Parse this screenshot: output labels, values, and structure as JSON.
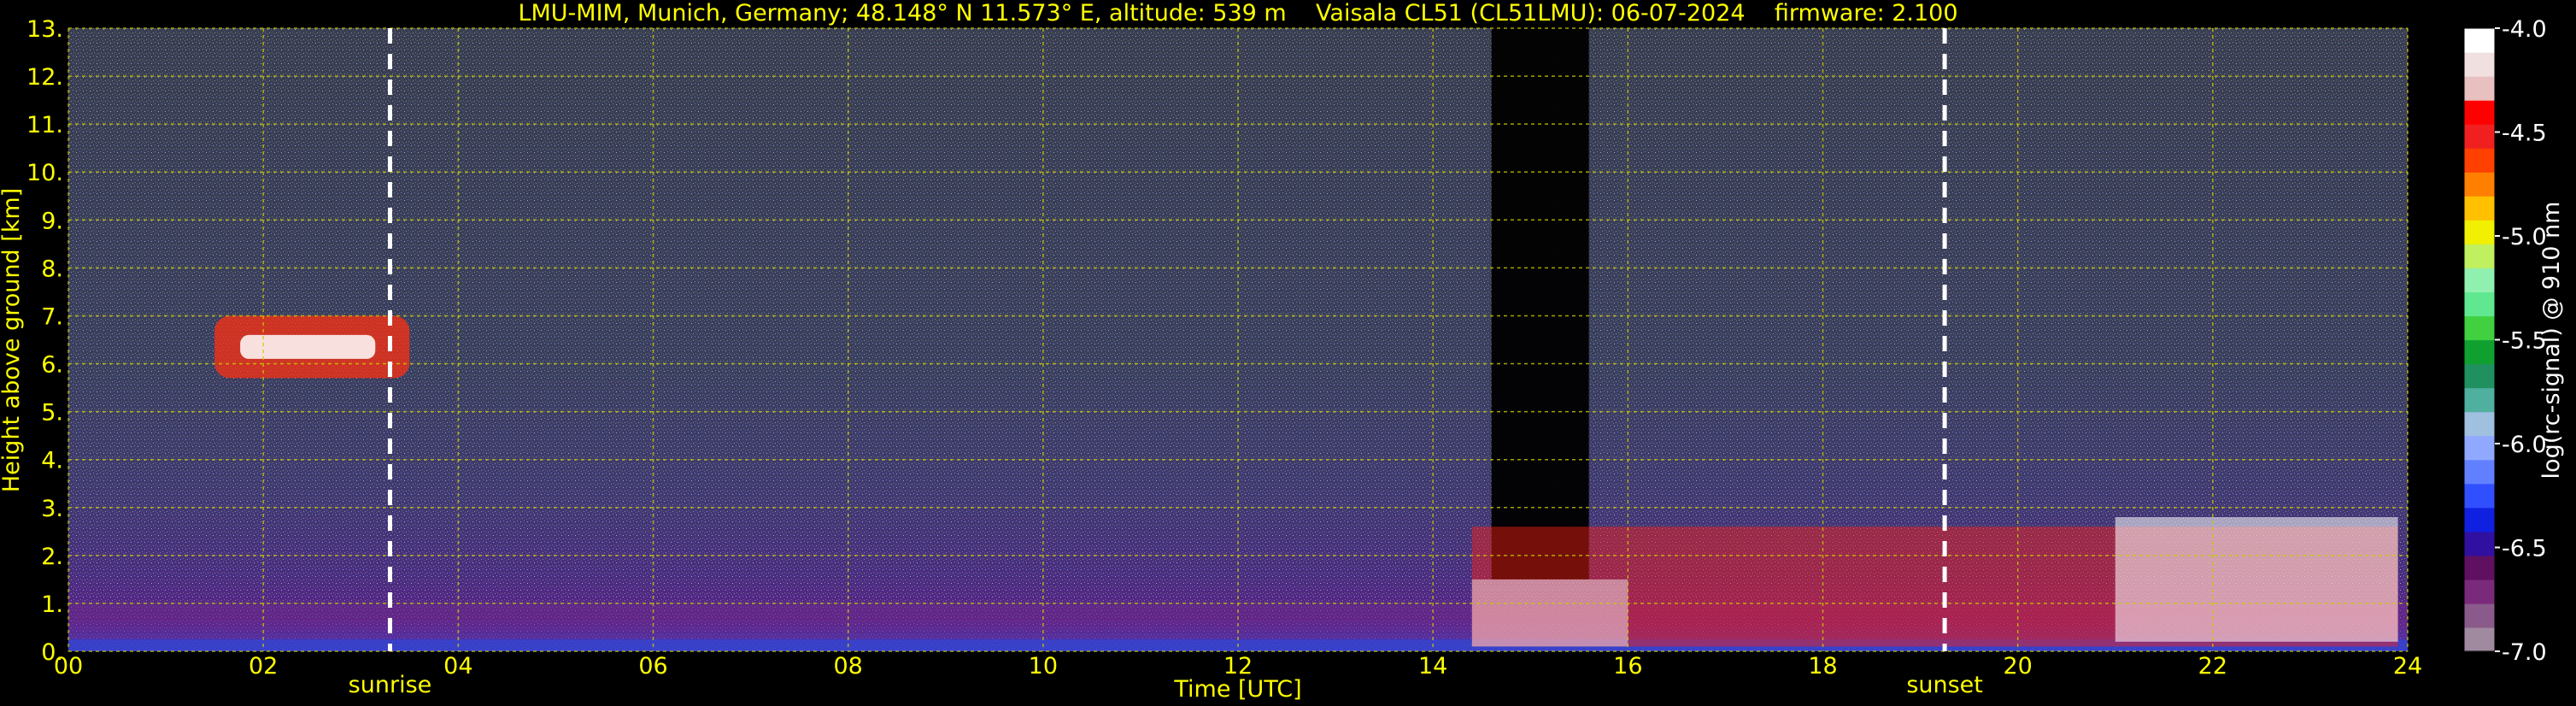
{
  "header": {
    "title": "LMU-MIM, Munich, Germany; 48.148° N 11.573° E, altitude: 539 m    Vaisala CL51 (CL51LMU): 06-07-2024    firmware: 2.100"
  },
  "chart_data": {
    "type": "heatmap",
    "title": "LMU-MIM, Munich, Germany; 48.148° N 11.573° E, altitude: 539 m    Vaisala CL51 (CL51LMU): 06-07-2024    firmware: 2.100",
    "xlabel": "Time [UTC]",
    "ylabel": "Height above ground [km]",
    "xlim": [
      0,
      24
    ],
    "ylim": [
      0,
      13
    ],
    "x_ticks": [
      "00",
      "02",
      "04",
      "06",
      "08",
      "10",
      "12",
      "14",
      "16",
      "18",
      "20",
      "22",
      "24"
    ],
    "y_ticks": [
      "0.",
      "1.",
      "2.",
      "3.",
      "4.",
      "5.",
      "6.",
      "7.",
      "8.",
      "9.",
      "10.",
      "11.",
      "12.",
      "13."
    ],
    "grid": true,
    "colorbar": {
      "label": "log(rc-signal) @ 910 nm",
      "range": [
        -7.0,
        -4.0
      ],
      "ticks": [
        "-4.0",
        "-4.5",
        "-5.0",
        "-5.5",
        "-6.0",
        "-6.5",
        "-7.0"
      ],
      "colors": [
        "#a08aa0",
        "#8a5a8a",
        "#7a2a7a",
        "#601060",
        "#3010a0",
        "#1020e0",
        "#3050ff",
        "#6080ff",
        "#90a8ff",
        "#a0c0e0",
        "#50b0a0",
        "#209060",
        "#10a030",
        "#40d040",
        "#60e890",
        "#90f0b0",
        "#c0f060",
        "#f0f000",
        "#ffc000",
        "#ff8000",
        "#ff4000",
        "#f02020",
        "#ff0000",
        "#e8c0c0",
        "#f0e0e0",
        "#ffffff"
      ]
    },
    "events": [
      {
        "name": "sunrise",
        "x": 3.3
      },
      {
        "name": "sunset",
        "x": 19.25
      }
    ],
    "features": {
      "boundary_layer_km": [
        0.0,
        1.0
      ],
      "upper_cloud_layer": {
        "x_range": [
          1.5,
          3.5
        ],
        "height_km": [
          5.7,
          7.0
        ]
      },
      "signal_blackout": {
        "x_range": [
          14.6,
          15.6
        ]
      },
      "low_cloud": {
        "x_range": [
          14.4,
          23.9
        ],
        "height_km": [
          0.1,
          3.5
        ]
      }
    }
  }
}
